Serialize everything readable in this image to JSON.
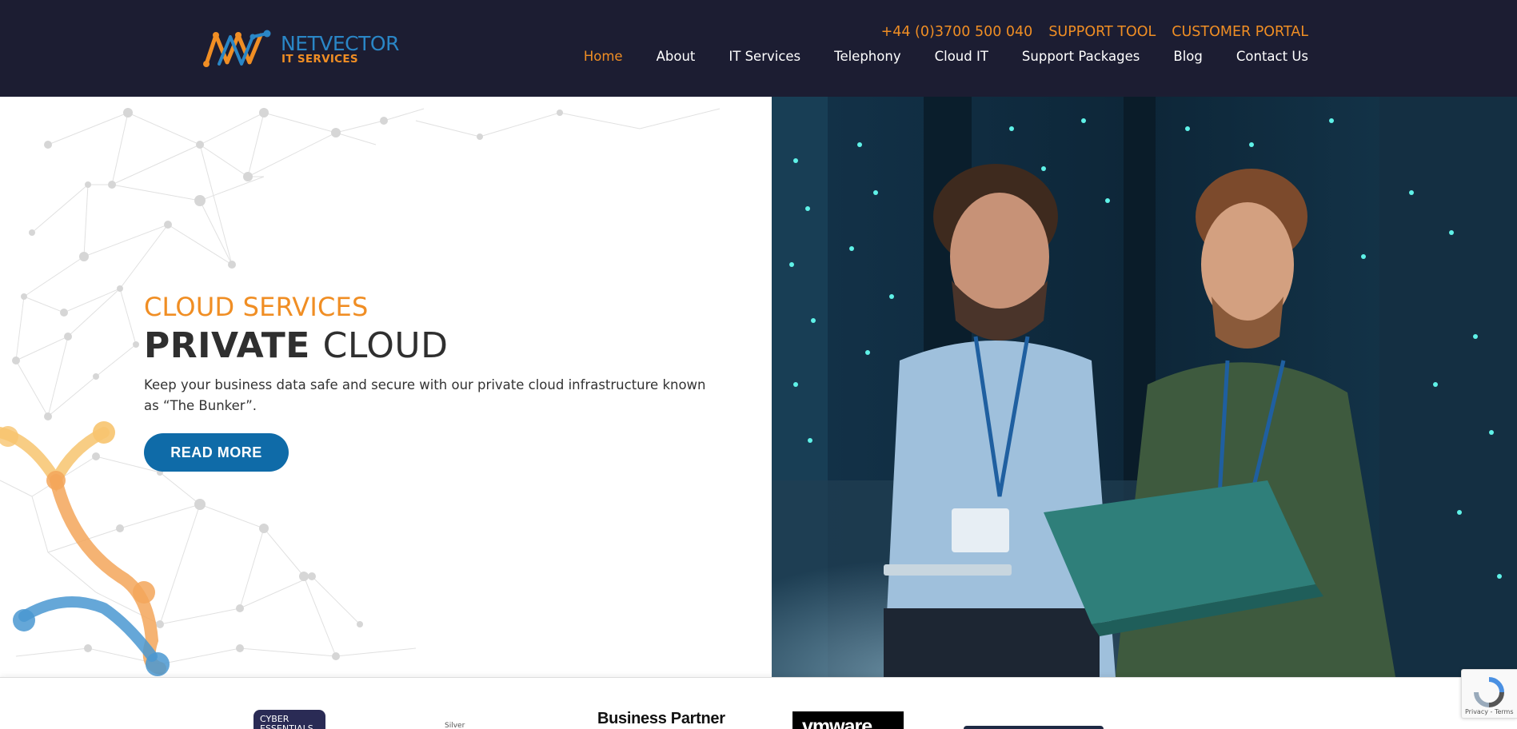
{
  "header": {
    "logo": {
      "name": "NETVECTOR",
      "sub": "IT SERVICES"
    },
    "top_links": [
      "+44 (0)3700 500 040",
      "SUPPORT TOOL",
      "CUSTOMER PORTAL"
    ],
    "nav": [
      {
        "label": "Home",
        "active": true
      },
      {
        "label": "About",
        "active": false
      },
      {
        "label": "IT Services",
        "active": false
      },
      {
        "label": "Telephony",
        "active": false
      },
      {
        "label": "Cloud IT",
        "active": false
      },
      {
        "label": "Support Packages",
        "active": false
      },
      {
        "label": "Blog",
        "active": false
      },
      {
        "label": "Contact Us",
        "active": false
      }
    ]
  },
  "hero": {
    "eyebrow": "CLOUD SERVICES",
    "headline_strong": "PRIVATE",
    "headline_light": "CLOUD",
    "lead": "Keep your business data safe and secure with our private cloud infrastructure known as “The Bunker”.",
    "cta_label": "READ MORE"
  },
  "partners": {
    "cyber": "CYBER ESSENTIALS",
    "silver": "Silver",
    "business_partner": "Business Partner",
    "vmware": "vmware"
  },
  "recaptcha": {
    "text": "Privacy - Terms"
  },
  "colors": {
    "header_bg": "#1c1d32",
    "accent_orange": "#f08e24",
    "brand_blue": "#0f6ba8",
    "logo_blue": "#2a86c6"
  },
  "icons": [
    "netvector-logo-mark",
    "recaptcha-icon"
  ]
}
